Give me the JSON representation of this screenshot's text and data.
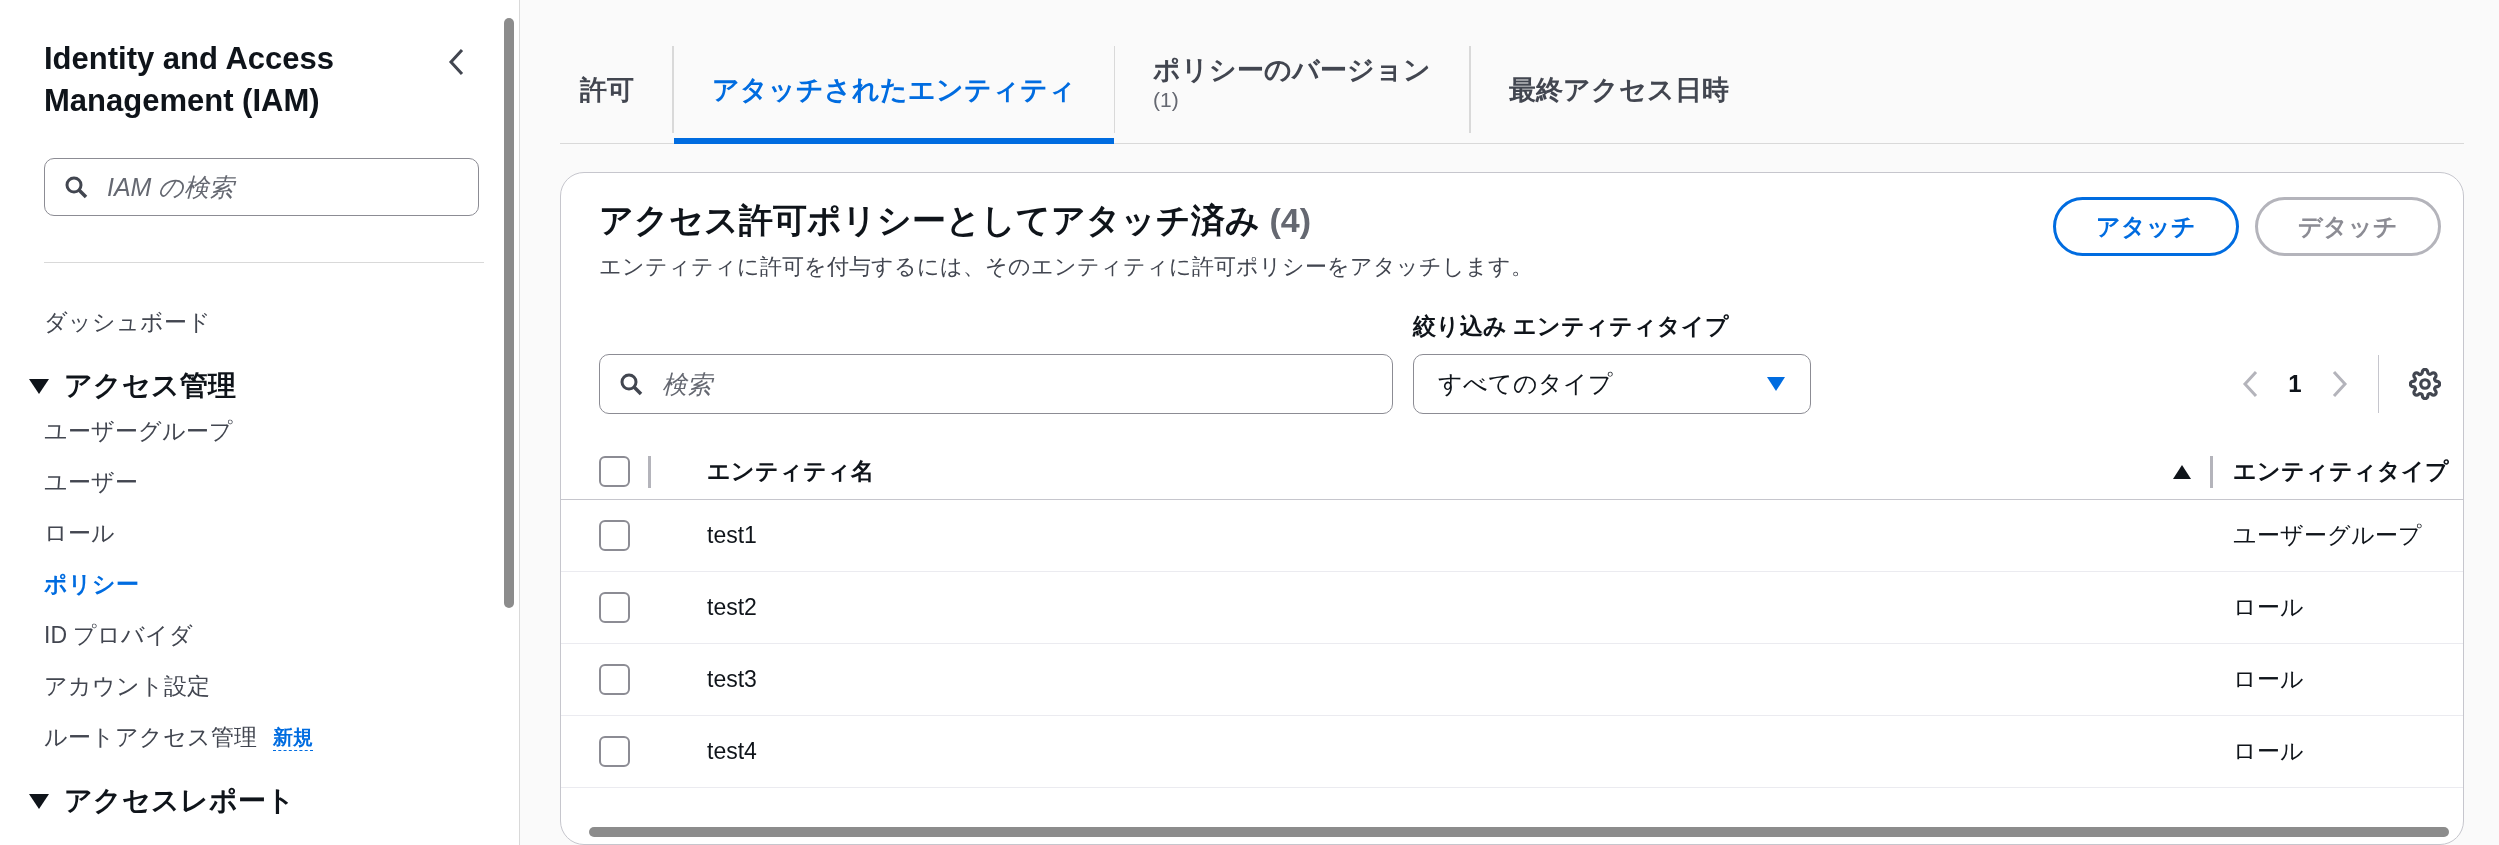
{
  "sidebar": {
    "title": "Identity and Access Management (IAM)",
    "search": {
      "placeholder": "IAM の検索"
    },
    "items": [
      {
        "kind": "link",
        "label": "ダッシュボード",
        "selected": false
      },
      {
        "kind": "section",
        "label": "アクセス管理",
        "expanded": true,
        "children": [
          {
            "kind": "link",
            "label": "ユーザーグループ",
            "selected": false
          },
          {
            "kind": "link",
            "label": "ユーザー",
            "selected": false
          },
          {
            "kind": "link",
            "label": "ロール",
            "selected": false
          },
          {
            "kind": "link",
            "label": "ポリシー",
            "selected": true
          },
          {
            "kind": "link",
            "label": "ID プロバイダ",
            "selected": false
          },
          {
            "kind": "link",
            "label": "アカウント設定",
            "selected": false
          },
          {
            "kind": "link",
            "label": "ルートアクセス管理",
            "selected": false,
            "badge": "新規"
          }
        ]
      },
      {
        "kind": "section",
        "label": "アクセスレポート",
        "expanded": true
      }
    ]
  },
  "tabs": [
    {
      "label": "許可",
      "selected": false
    },
    {
      "label": "アタッチされたエンティティ",
      "selected": true
    },
    {
      "label": "ポリシーのバージョン",
      "count": "(1)",
      "selected": false
    },
    {
      "label": "最終アクセス日時",
      "selected": false
    }
  ],
  "panel": {
    "title": "アクセス許可ポリシーとしてアタッチ済み",
    "count": "(4)",
    "description": "エンティティに許可を付与するには、そのエンティティに許可ポリシーをアタッチします。",
    "buttons": [
      {
        "label": "アタッチ",
        "disabled": false
      },
      {
        "label": "デタッチ",
        "disabled": true
      }
    ],
    "search": {
      "placeholder": "検索"
    },
    "filter": {
      "label": "絞り込み エンティティタイプ",
      "value": "すべてのタイプ"
    },
    "pagination": {
      "page": "1"
    },
    "header_checked": false,
    "columns": [
      {
        "label": "エンティティ名",
        "sorted": true
      },
      {
        "label": "エンティティタイプ",
        "sorted": false
      }
    ],
    "rows": [
      {
        "name": "test1",
        "type": "ユーザーグループ",
        "checked": false
      },
      {
        "name": "test2",
        "type": "ロール",
        "checked": false
      },
      {
        "name": "test3",
        "type": "ロール",
        "checked": false
      },
      {
        "name": "test4",
        "type": "ロール",
        "checked": false
      }
    ]
  }
}
